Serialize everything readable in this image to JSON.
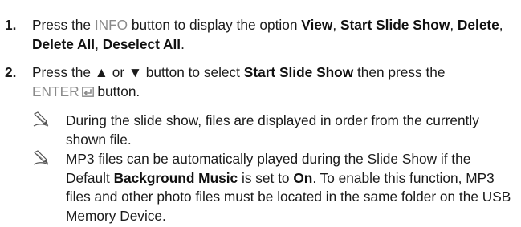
{
  "steps": [
    {
      "num": "1.",
      "t1": "Press the ",
      "info_kw": "INFO",
      "t2": " button to display the option ",
      "opt_view": "View",
      "sep1": ", ",
      "opt_start": "Start Slide Show",
      "sep2": ", ",
      "opt_delete": "Delete",
      "sep3": ", ",
      "opt_delete_all": "Delete All",
      "sep4": ", ",
      "opt_deselect": "Deselect All",
      "t3": "."
    },
    {
      "num": "2.",
      "t1": "Press the ▲ or ▼ button to select ",
      "opt_start": "Start Slide Show",
      "t2": " then press the",
      "enter_kw": "ENTER",
      "t3": " button."
    }
  ],
  "notes": [
    {
      "icon": "note-pencil-icon",
      "text": "During the slide show, files are displayed in order from the currently shown file."
    },
    {
      "icon": "note-pencil-icon",
      "t1": "MP3 files can be automatically played during the Slide Show if the Default ",
      "bg_music": "Background Music",
      "t2": " is set to ",
      "on": "On",
      "t3": ". To enable this function, MP3 files and other photo files must be located in the same folder on the USB Memory Device."
    }
  ]
}
